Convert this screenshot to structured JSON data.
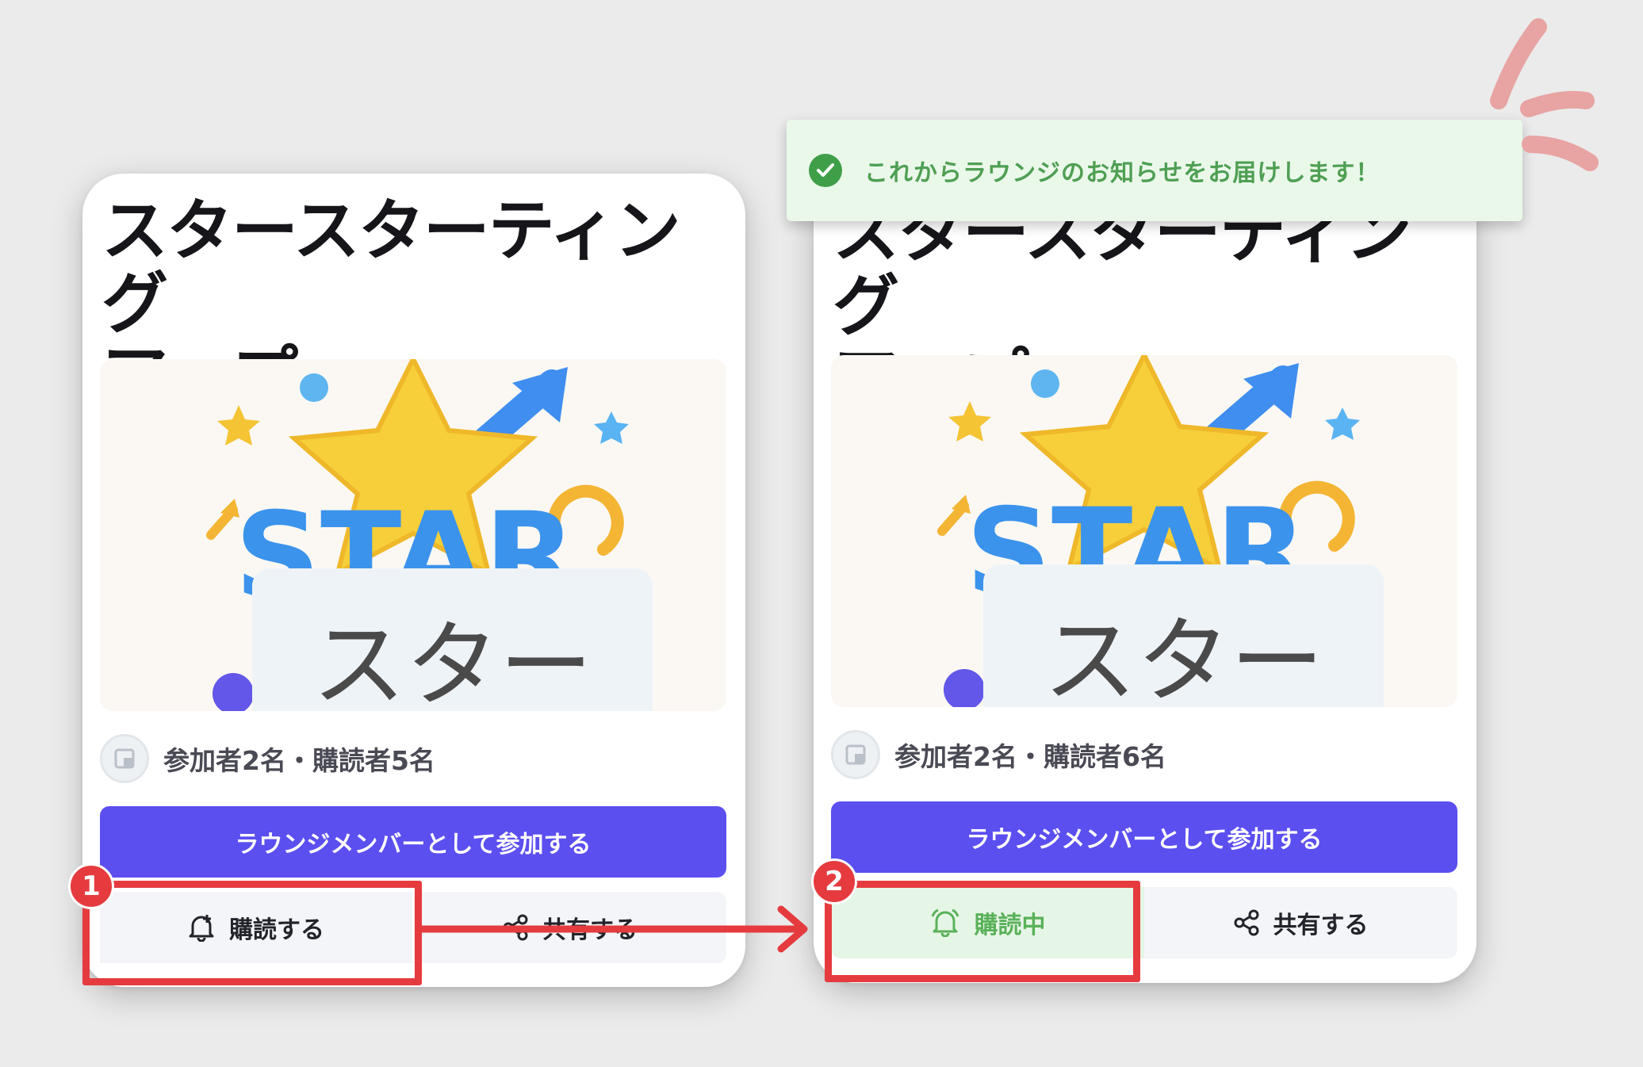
{
  "toast": {
    "message": "これからラウンジのお知らせをお届けします！"
  },
  "cards": {
    "before": {
      "title_line1": "スタースターティング",
      "title_line2": "アップ",
      "hero_text": "スター",
      "meta": "参加者2名・購読者5名",
      "join_label": "ラウンジメンバーとして参加する",
      "subscribe_label": "購読する",
      "share_label": "共有する"
    },
    "after": {
      "title_line1": "スタースターティング",
      "title_line2": "アップ",
      "hero_text": "スター",
      "meta": "参加者2名・購読者6名",
      "join_label": "ラウンジメンバーとして参加する",
      "subscribe_label": "購読中",
      "share_label": "共有する"
    }
  },
  "annotations": {
    "step1": "1",
    "step2": "2"
  },
  "colors": {
    "accent": "#5b4ff0",
    "annotation_red": "#e53b3f",
    "success_green": "#3f9f49",
    "toast_bg": "#eaf8ea"
  },
  "icons": [
    "bell-plus-icon",
    "bell-ringing-icon",
    "share-icon",
    "check-circle-icon",
    "avatar-icon",
    "arrow-right-icon"
  ]
}
